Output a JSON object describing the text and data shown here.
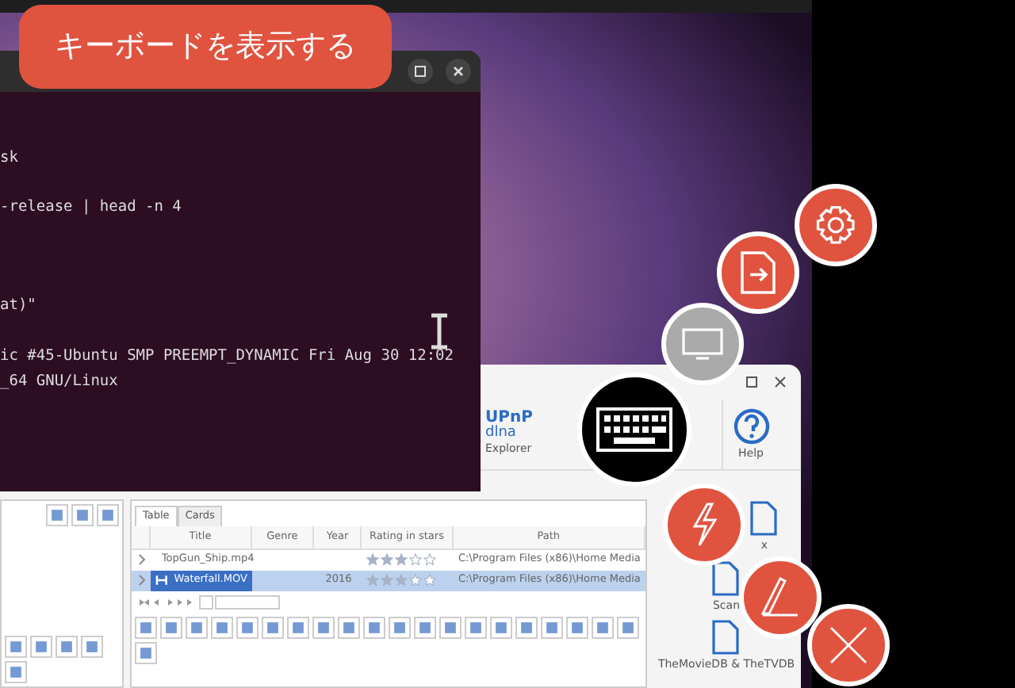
{
  "toast": {
    "text": "キーボードを表示する"
  },
  "terminal": {
    "lines": [
      "sk",
      "-release | head -n 4",
      "at)\"",
      "ic #45-Ubuntu SMP PREEMPT_DYNAMIC Fri Aug 30 12:02",
      "_64 GNU/Linux"
    ]
  },
  "app": {
    "ribbon": {
      "explorer": {
        "logo_top": "UPnP",
        "logo_bottom": "dlna",
        "label": "Explorer"
      },
      "help": {
        "label": "Help"
      }
    },
    "tabs": [
      {
        "label": "Table",
        "selected": true
      },
      {
        "label": "Cards",
        "selected": false
      }
    ],
    "columns": [
      "Title",
      "Genre",
      "Year",
      "Rating in stars",
      "Path"
    ],
    "rows": [
      {
        "title": "TopGun_Ship.mp4",
        "year": "",
        "stars": 3,
        "path": "C:\\Program Files (x86)\\Home Media",
        "selected": false
      },
      {
        "title": "Waterfall.MOV",
        "year": "2016",
        "stars": 3,
        "path": "C:\\Program Files (x86)\\Home Media",
        "selected": true
      }
    ],
    "side_items": [
      {
        "label": "x"
      },
      {
        "label": "Scan"
      },
      {
        "label": "TheMovieDB & TheTVDB"
      }
    ]
  }
}
